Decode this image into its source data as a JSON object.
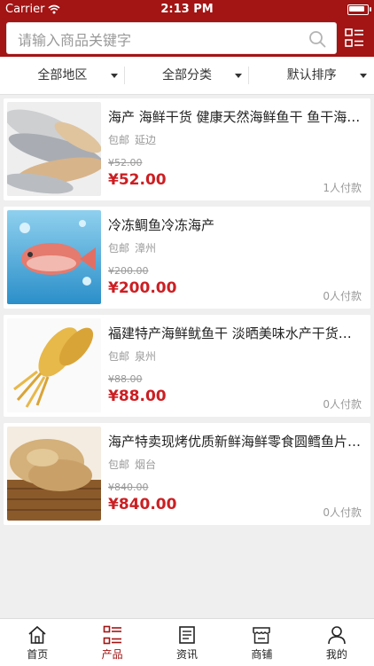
{
  "status": {
    "carrier": "Carrier",
    "time": "2:13 PM"
  },
  "search": {
    "placeholder": "请输入商品关键字"
  },
  "filters": [
    "全部地区",
    "全部分类",
    "默认排序"
  ],
  "products": [
    {
      "title": "海产 海鲜干货 健康天然海鲜鱼干 鱼干海…",
      "shipping": "包邮",
      "location": "延边",
      "old_price": "¥52.00",
      "price": "¥52.00",
      "sales": "1人付款",
      "image_icon": "dried-fish-image"
    },
    {
      "title": "冷冻鲷鱼冷冻海产",
      "shipping": "包邮",
      "location": "漳州",
      "old_price": "¥200.00",
      "price": "¥200.00",
      "sales": "0人付款",
      "image_icon": "red-snapper-image"
    },
    {
      "title": "福建特产海鲜鱿鱼干 淡晒美味水产干货…",
      "shipping": "包邮",
      "location": "泉州",
      "old_price": "¥88.00",
      "price": "¥88.00",
      "sales": "0人付款",
      "image_icon": "dried-squid-image"
    },
    {
      "title": "海产特卖现烤优质新鲜海鲜零食圆鳕鱼片…",
      "shipping": "包邮",
      "location": "烟台",
      "old_price": "¥840.00",
      "price": "¥840.00",
      "sales": "0人付款",
      "image_icon": "cod-slices-image"
    }
  ],
  "tabs": [
    {
      "label": "首页",
      "icon": "home-icon",
      "active": false
    },
    {
      "label": "产品",
      "icon": "list-icon",
      "active": true
    },
    {
      "label": "资讯",
      "icon": "news-icon",
      "active": false
    },
    {
      "label": "商铺",
      "icon": "store-icon",
      "active": false
    },
    {
      "label": "我的",
      "icon": "user-icon",
      "active": false
    }
  ],
  "colors": {
    "brand": "#a31414",
    "price": "#cc1f23"
  }
}
